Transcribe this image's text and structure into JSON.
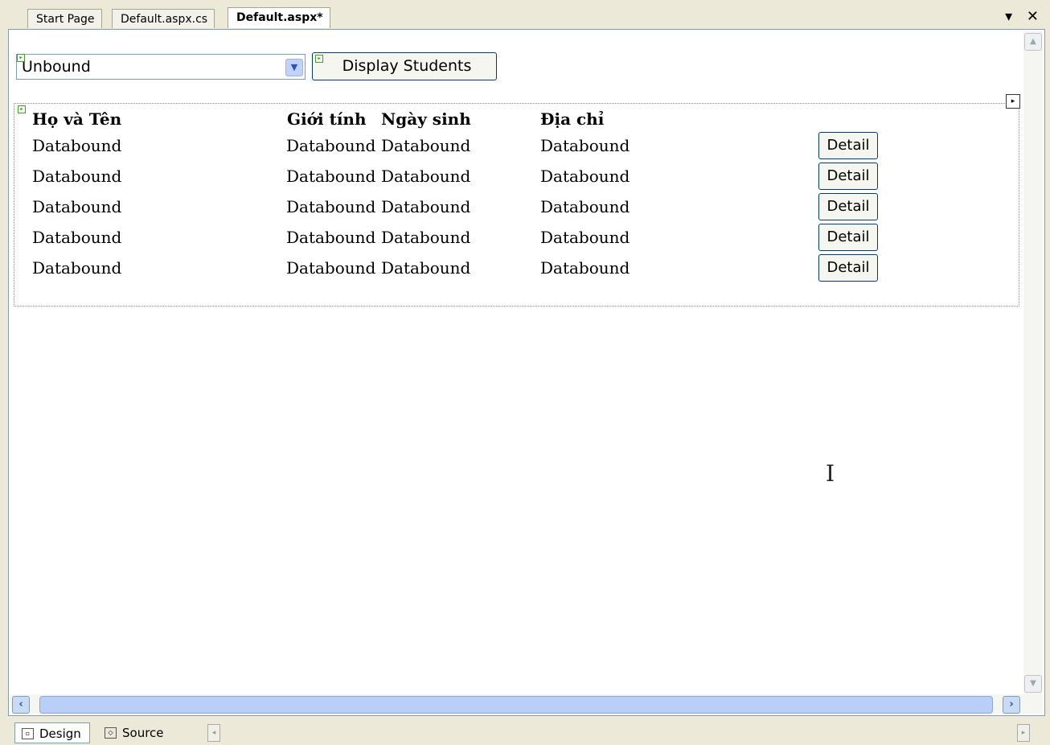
{
  "tabs": [
    {
      "label": "Start Page"
    },
    {
      "label": "Default.aspx.cs"
    },
    {
      "label": "Default.aspx*"
    }
  ],
  "tab_controls": {
    "dropdown_glyph": "▾",
    "close_glyph": "✕"
  },
  "dropdown": {
    "value": "Unbound"
  },
  "display_button": {
    "label": "Display Students"
  },
  "grid": {
    "headers": [
      "Họ và Tên",
      "Giới tính",
      "Ngày sinh",
      "Địa chỉ"
    ],
    "rows": [
      [
        "Databound",
        "Databound",
        "Databound",
        "Databound"
      ],
      [
        "Databound",
        "Databound",
        "Databound",
        "Databound"
      ],
      [
        "Databound",
        "Databound",
        "Databound",
        "Databound"
      ],
      [
        "Databound",
        "Databound",
        "Databound",
        "Databound"
      ],
      [
        "Databound",
        "Databound",
        "Databound",
        "Databound"
      ]
    ],
    "detail_label": "Detail"
  },
  "view_tabs": [
    {
      "label": "Design"
    },
    {
      "label": "Source"
    }
  ]
}
